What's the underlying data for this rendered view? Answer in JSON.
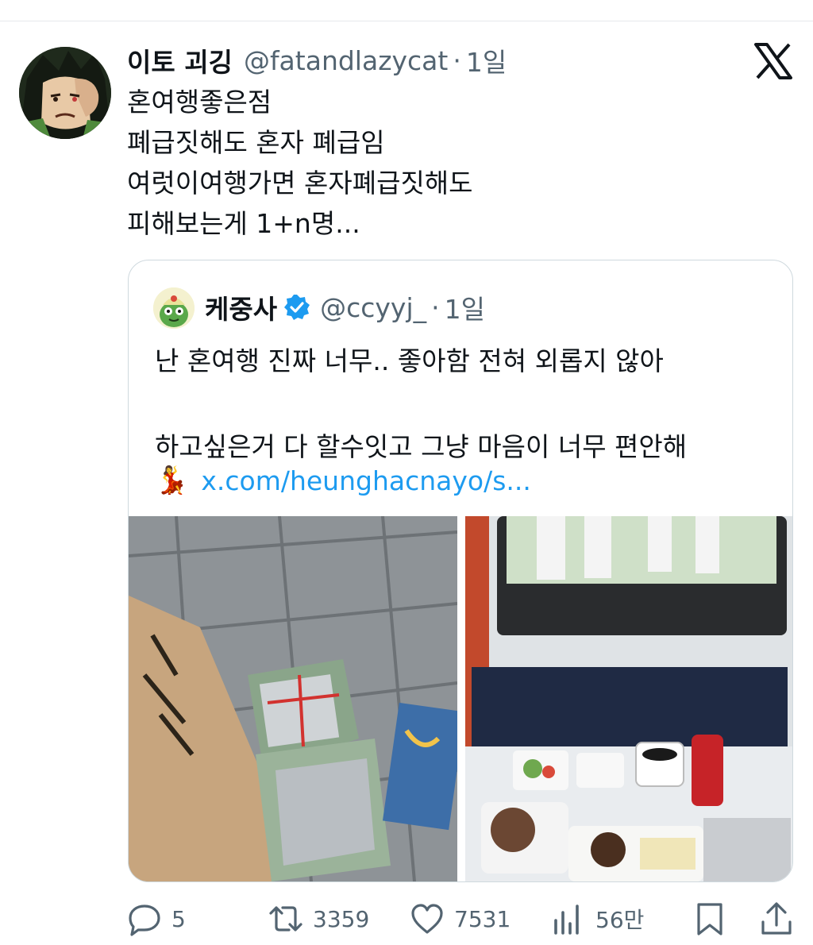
{
  "tweet": {
    "author_name": "이토 괴깅",
    "author_handle": "@fatandlazycat",
    "separator": "·",
    "time": "1일",
    "lines": [
      "혼여행좋은점",
      "폐급짓해도 혼자 폐급임",
      "여럿이여행가면 혼자폐급짓해도",
      "피해보는게 1+n명..."
    ]
  },
  "quote": {
    "author_name": "케중사",
    "author_handle": "@ccyyj_",
    "separator": "·",
    "time": "1일",
    "line1": "난 혼여행 진짜 너무.. 좋아함 전혀 외롭지 않아",
    "line2": "",
    "line3": "하고싶은거 다 할수잇고 그냥 마음이 너무 편안해",
    "emoji": "💃",
    "link": "x.com/heunghacnayo/s..."
  },
  "actions": {
    "replies": "5",
    "retweets": "3359",
    "likes": "7531",
    "views": "56만"
  },
  "icons": {
    "logo": "x-logo-icon",
    "verified": "verified-badge-icon",
    "reply": "reply-icon",
    "retweet": "retweet-icon",
    "like": "heart-icon",
    "views": "views-icon",
    "bookmark": "bookmark-icon",
    "share": "share-icon"
  },
  "colors": {
    "text": "#0f1419",
    "secondary": "#536471",
    "link": "#1d9bf0",
    "border": "#cfd9de"
  }
}
